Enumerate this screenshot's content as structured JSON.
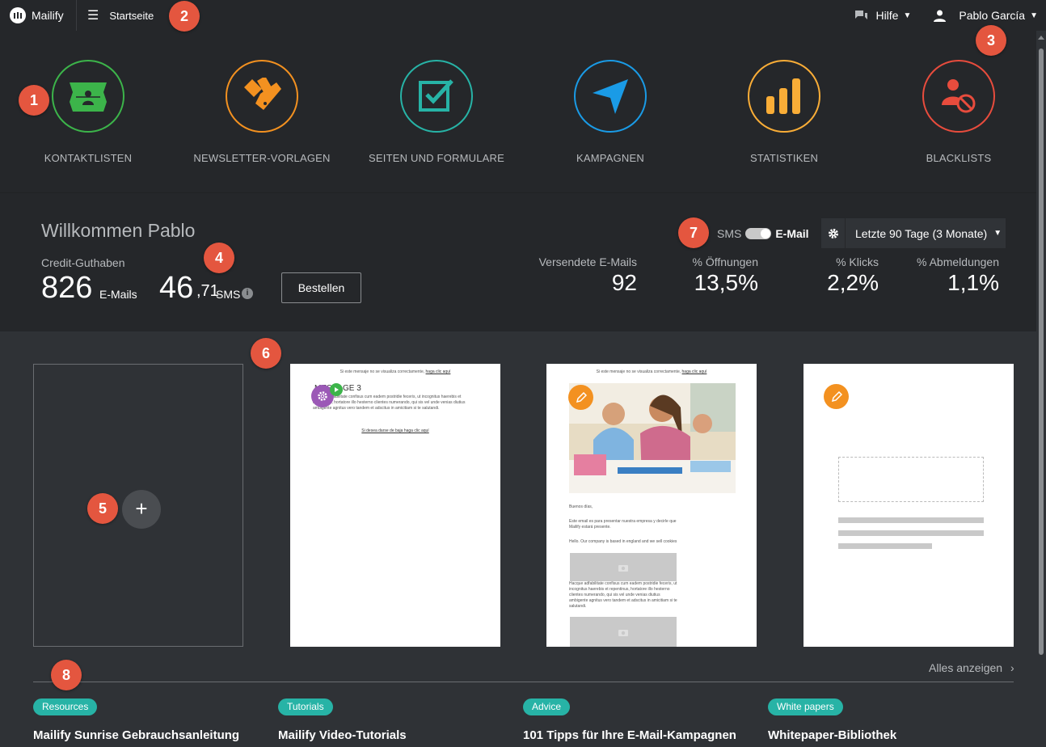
{
  "topbar": {
    "logo_text": "Mailify",
    "home_label": "Startseite",
    "help_label": "Hilfe",
    "user_name": "Pablo García"
  },
  "nav": [
    {
      "label": "KONTAKTLISTEN",
      "icon": "contact-list-icon",
      "color": "#3cb44a"
    },
    {
      "label": "NEWSLETTER-VORLAGEN",
      "icon": "template-icon",
      "color": "#f39120"
    },
    {
      "label": "SEITEN UND FORMULARE",
      "icon": "form-check-icon",
      "color": "#27b3a6"
    },
    {
      "label": "KAMPAGNEN",
      "icon": "send-icon",
      "color": "#1a9be6"
    },
    {
      "label": "STATISTIKEN",
      "icon": "bar-chart-icon",
      "color": "#f9ad37"
    },
    {
      "label": "BLACKLISTS",
      "icon": "blacklist-icon",
      "color": "#e84c3d"
    }
  ],
  "stats": {
    "welcome": "Willkommen Pablo",
    "credit_label": "Credit-Guthaben",
    "email_credit": "826",
    "email_unit": "E-Mails",
    "sms_credit_int": "46",
    "sms_credit_dec": ",71",
    "sms_unit": "SMS",
    "order_button": "Bestellen",
    "toggle_sms": "SMS",
    "toggle_email": "E-Mail",
    "period": "Letzte 90 Tage (3 Monate)",
    "metrics": [
      {
        "label": "Versendete E-Mails",
        "value": "92"
      },
      {
        "label": "% Öffnungen",
        "value": "13,5%"
      },
      {
        "label": "% Klicks",
        "value": "2,2%"
      },
      {
        "label": "% Abmeldungen",
        "value": "1,1%"
      }
    ]
  },
  "cards": {
    "new_plus": "+",
    "card2": {
      "top_line": "Si este mensaje no se visualiza correctamente,",
      "top_link": "haga clic aquí",
      "heading": "MESSAGE 3",
      "body": "Hacque adfabilitate confisus cum eadem postridie feceris, ut incognitus haerebis et repentinus, hortatore illo hesterno clientes numerando, qui sis vel unde venias diutius ambigente agnitus vero tandem et adscitus in amicitiam si te salutandi.",
      "unsub": "Si desea darse de baja haga clic aquí"
    },
    "card3": {
      "top_line": "Si este mensaje no se visualiza correctamente,",
      "top_link": "haga clic aquí",
      "greeting": "Buenos días,",
      "p1": "Este email es para presentar nuestra empresa y decirle que Mailify estará presente.",
      "p2": "Hello. Our company is based in england and we sell cookies",
      "p3": "Hacque adfabilitate confisus cum eadem postridie feceris, ut incognitus haerebis et repentinus, hortatore illo hesterno clientes numerando, qui sis vel unde venias diutius ambigente agnitus vero tandem et adscitus in amicitiam si te salutandi."
    }
  },
  "bottom": {
    "all_link": "Alles anzeigen",
    "resources": [
      {
        "tag": "Resources",
        "title": "Mailify Sunrise Gebrauchsanleitung"
      },
      {
        "tag": "Tutorials",
        "title": "Mailify Video-Tutorials"
      },
      {
        "tag": "Advice",
        "title": "101 Tipps für Ihre E-Mail-Kampagnen"
      },
      {
        "tag": "White papers",
        "title": "Whitepaper-Bibliothek"
      }
    ]
  },
  "callouts": [
    "1",
    "2",
    "3",
    "4",
    "5",
    "6",
    "7",
    "8"
  ]
}
